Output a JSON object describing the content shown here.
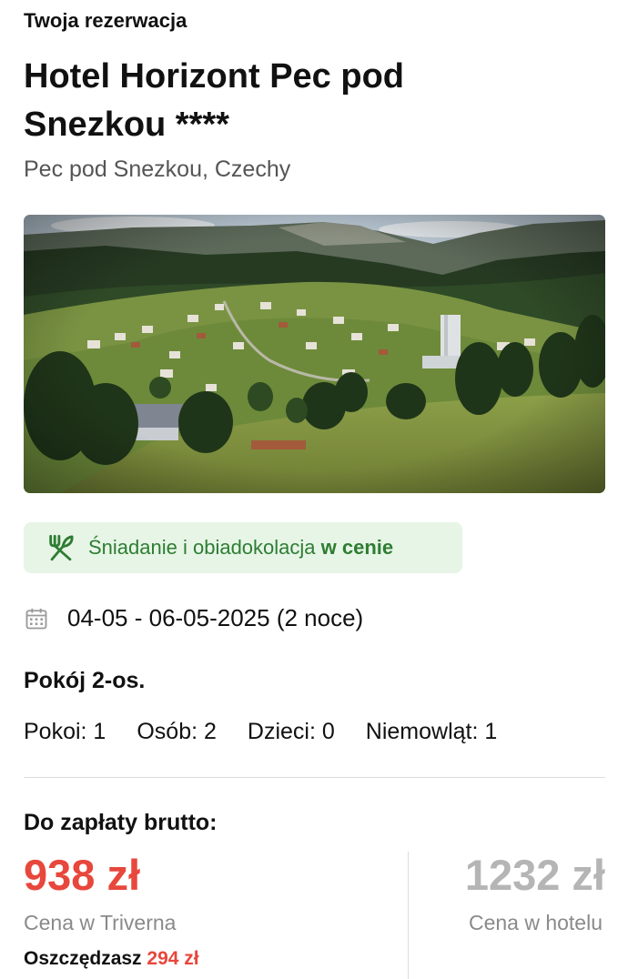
{
  "header": {
    "section_label": "Twoja rezerwacja"
  },
  "hotel": {
    "name": "Hotel Horizont Pec pod Snezkou ****",
    "location": "Pec pod Snezkou, Czechy"
  },
  "meal_plan": {
    "icon": "cutlery-icon",
    "text": "Śniadanie i obiadokolacja ",
    "emphasis": "w cenie",
    "color": "#2e7d32",
    "background": "#e7f5e7"
  },
  "stay": {
    "icon": "calendar-icon",
    "dates": "04-05 - 06-05-2025 (2 noce)"
  },
  "room": {
    "type": "Pokój 2-os.",
    "occupancy": [
      {
        "label": "Pokoi: 1"
      },
      {
        "label": "Osób: 2"
      },
      {
        "label": "Dzieci: 0"
      },
      {
        "label": "Niemowląt: 1"
      }
    ]
  },
  "payment": {
    "label": "Do zapłaty brutto:",
    "our_price": "938 zł",
    "our_price_label": "Cena w Triverna",
    "savings_label": "Oszczędzasz ",
    "savings_amount": "294 zł",
    "hotel_price": "1232 zł",
    "hotel_price_label": "Cena w hotelu",
    "accent_color": "#e8473c"
  }
}
